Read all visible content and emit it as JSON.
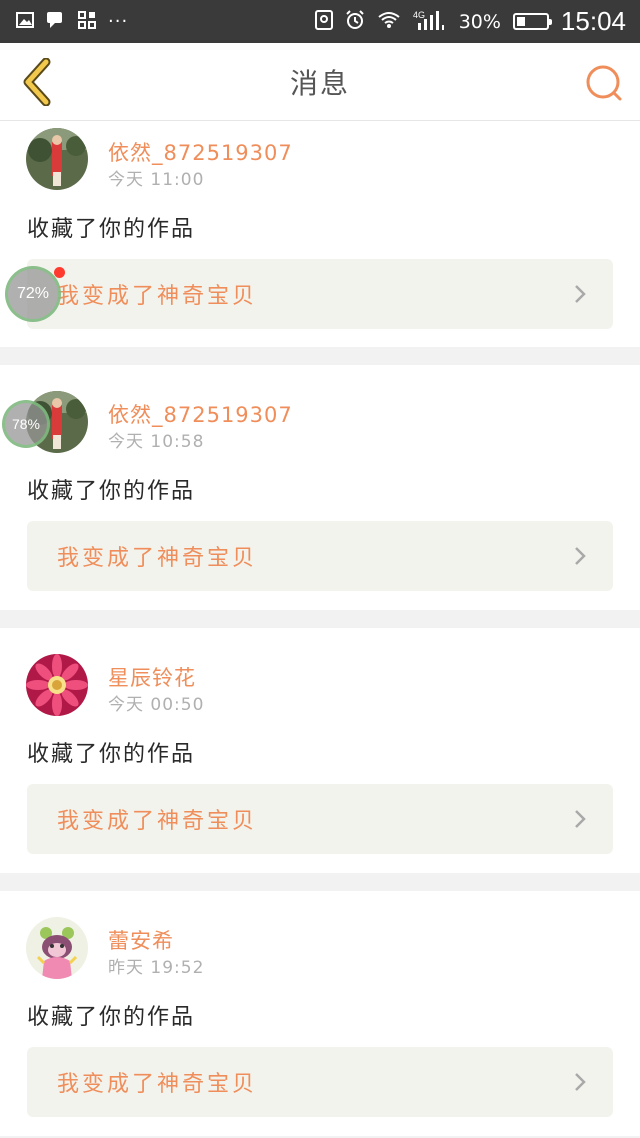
{
  "status_bar": {
    "dots": "···",
    "network": "4G",
    "battery_text": "30%",
    "battery_level": 0.3,
    "time": "15:04"
  },
  "header": {
    "title": "消息"
  },
  "messages": [
    {
      "username": "依然_872519307",
      "time": "今天 11:00",
      "action": "收藏了你的作品",
      "work_title": "我变成了神奇宝贝",
      "badge": "72%"
    },
    {
      "username": "依然_872519307",
      "time": "今天 10:58",
      "action": "收藏了你的作品",
      "work_title": "我变成了神奇宝贝",
      "badge": "78%"
    },
    {
      "username": "星辰铃花",
      "time": "今天 00:50",
      "action": "收藏了你的作品",
      "work_title": "我变成了神奇宝贝"
    },
    {
      "username": "蕾安希",
      "time": "昨天 19:52",
      "action": "收藏了你的作品",
      "work_title": "我变成了神奇宝贝"
    }
  ],
  "colors": {
    "accent": "#ef8e5a",
    "header_back": "#f2c94c"
  }
}
